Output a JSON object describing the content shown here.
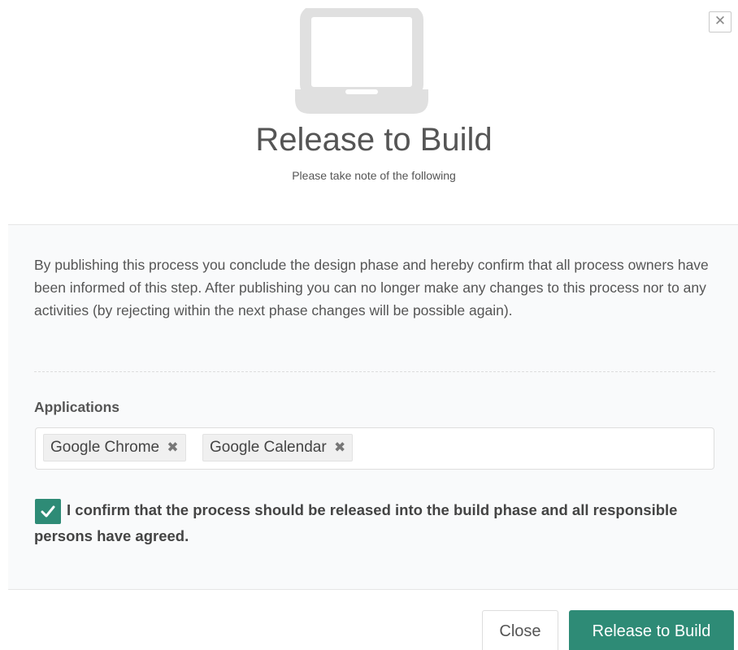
{
  "dialog": {
    "close_icon_glyph": "✕",
    "icon": "laptop-icon",
    "title": "Release to Build",
    "subtitle": "Please take note of the following"
  },
  "body": {
    "description": "By publishing this process you conclude the design phase and hereby confirm that all process owners have been informed of this step. After publishing you can no longer make any changes to this process nor to any activities (by rejecting within the next phase changes will be possible again).",
    "applications_label": "Applications",
    "applications": [
      {
        "label": "Google Chrome",
        "remove_glyph": "✖"
      },
      {
        "label": "Google Calendar",
        "remove_glyph": "✖"
      }
    ],
    "confirm_checked": true,
    "confirm_text": "I confirm that the process should be released into the build phase and all responsible persons have agreed."
  },
  "footer": {
    "close_label": "Close",
    "release_label": "Release to Build"
  },
  "colors": {
    "accent": "#2e8b76",
    "icon_gray": "#e0e0e0",
    "text": "#555555"
  }
}
